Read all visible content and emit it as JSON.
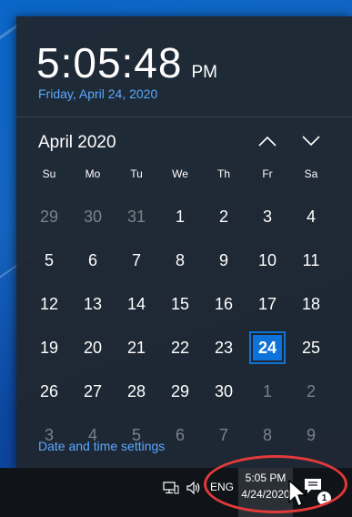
{
  "flyout": {
    "time": "5:05:48",
    "ampm": "PM",
    "date_long": "Friday, April 24, 2020",
    "month_title": "April 2020",
    "settings_link": "Date and time settings"
  },
  "calendar": {
    "days_of_week": [
      "Su",
      "Mo",
      "Tu",
      "We",
      "Th",
      "Fr",
      "Sa"
    ],
    "weeks": [
      [
        "29",
        "30",
        "31",
        "1",
        "2",
        "3",
        "4"
      ],
      [
        "5",
        "6",
        "7",
        "8",
        "9",
        "10",
        "11"
      ],
      [
        "12",
        "13",
        "14",
        "15",
        "16",
        "17",
        "18"
      ],
      [
        "19",
        "20",
        "21",
        "22",
        "23",
        "24",
        "25"
      ],
      [
        "26",
        "27",
        "28",
        "29",
        "30",
        "1",
        "2"
      ],
      [
        "3",
        "4",
        "5",
        "6",
        "7",
        "8",
        "9"
      ]
    ],
    "selected_day": "24"
  },
  "taskbar": {
    "language": "ENG",
    "time": "5:05 PM",
    "date": "4/24/2020",
    "notification_count": "1"
  },
  "colors": {
    "accent": "#0e73d8",
    "link": "#5aa9ff",
    "highlight_ring": "#e23a3a"
  },
  "icons": {
    "nav_up": "chevron-up-icon",
    "nav_down": "chevron-down-icon",
    "network": "network-icon",
    "volume": "volume-icon",
    "notifications": "action-center-icon",
    "cursor": "mouse-pointer-icon"
  }
}
